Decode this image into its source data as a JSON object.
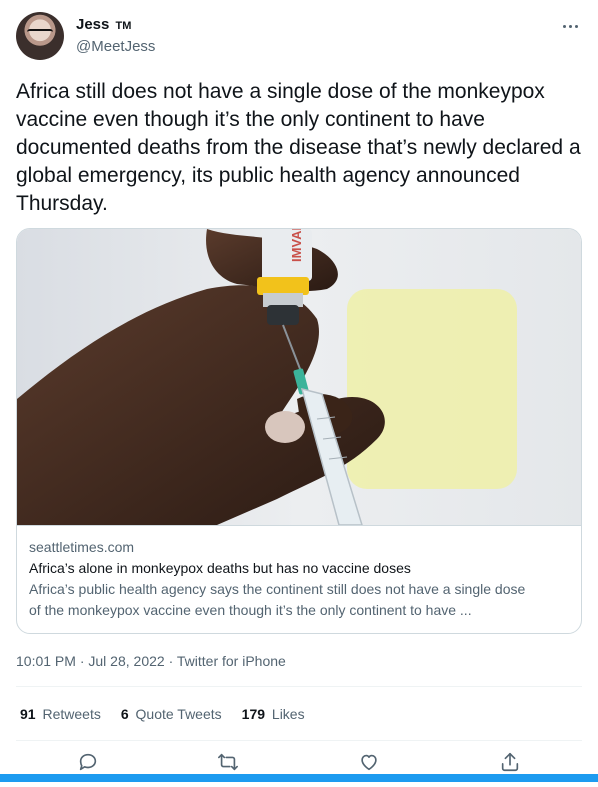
{
  "author": {
    "display_name": "Jess",
    "badge": "TM",
    "handle": "@MeetJess"
  },
  "tweet_text": "Africa still does not have a single dose of the monkeypox vaccine even though it’s the only continent to have documented deaths from the disease that’s newly declared a global emergency, its public health agency announced Thursday.",
  "card": {
    "domain": "seattletimes.com",
    "title": "Africa’s alone in monkeypox deaths but has no vaccine doses",
    "description_line1": "Africa’s public health agency says the continent still does not have a single dose",
    "description_line2": "of the monkeypox vaccine even though it’s the only continent to have ...",
    "vial_label": "IMVANU"
  },
  "meta": {
    "time": "10:01 PM",
    "separator": " · ",
    "date": "Jul 28, 2022",
    "source": "Twitter for iPhone"
  },
  "stats": {
    "retweets_count": "91",
    "retweets_label": "Retweets",
    "quotes_count": "6",
    "quotes_label": "Quote Tweets",
    "likes_count": "179",
    "likes_label": "Likes"
  },
  "icons": {
    "reply": "reply-icon",
    "retweet": "retweet-icon",
    "like": "heart-icon",
    "share": "share-icon",
    "more": "more-icon"
  },
  "colors": {
    "accent": "#1d9bf0",
    "text": "#0f1419",
    "secondary": "#536471",
    "border": "#cfd9de"
  }
}
